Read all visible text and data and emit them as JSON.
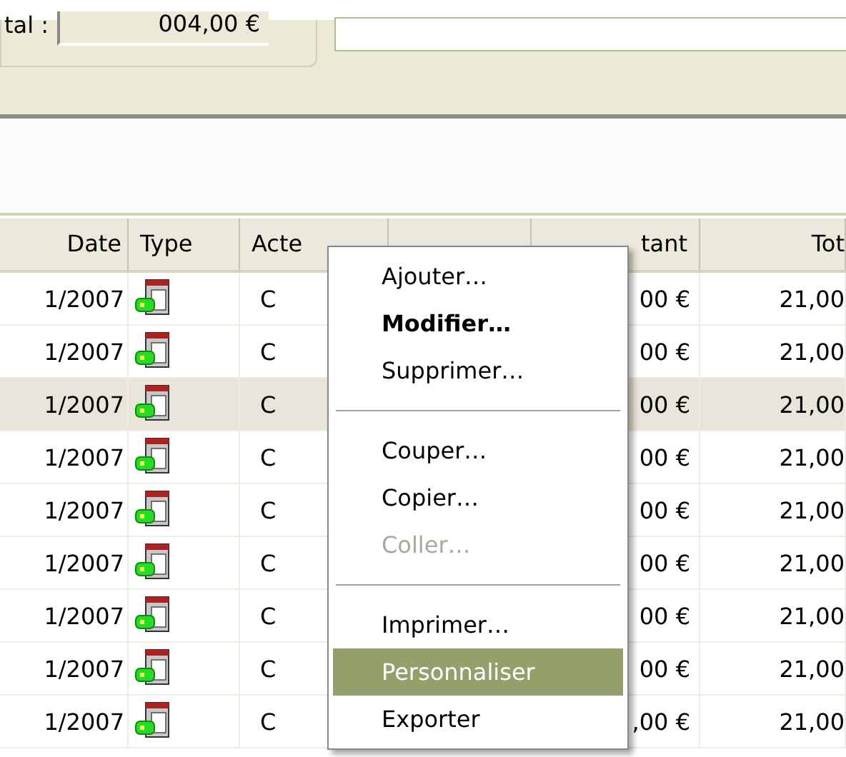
{
  "summary": {
    "label": "tal :",
    "value": "004,00 €"
  },
  "table": {
    "columns": [
      {
        "label": "Date"
      },
      {
        "label": "Type"
      },
      {
        "label": "Acte"
      },
      {},
      {
        "label": "tant"
      },
      {
        "label": "Tot"
      }
    ],
    "rows": [
      {
        "date": "1/2007",
        "acte": "C",
        "montant": "00 €",
        "total": "21,00",
        "selected": false
      },
      {
        "date": "1/2007",
        "acte": "C",
        "montant": "00 €",
        "total": "21,00",
        "selected": false
      },
      {
        "date": "1/2007",
        "acte": "C",
        "montant": "00 €",
        "total": "21,00",
        "selected": true
      },
      {
        "date": "1/2007",
        "acte": "C",
        "montant": "00 €",
        "total": "21,00",
        "selected": false
      },
      {
        "date": "1/2007",
        "acte": "C",
        "montant": "00 €",
        "total": "21,00",
        "selected": false
      },
      {
        "date": "1/2007",
        "acte": "C",
        "montant": "00 €",
        "total": "21,00",
        "selected": false
      },
      {
        "date": "1/2007",
        "acte": "C",
        "montant": "00 €",
        "total": "21,00",
        "selected": false
      },
      {
        "date": "1/2007",
        "acte": "C",
        "montant": "00 €",
        "total": "21,00",
        "selected": false
      },
      {
        "date": "1/2007",
        "acte": "C",
        "montant": ",00 €",
        "total": "21,00",
        "selected": false
      }
    ]
  },
  "context_menu": [
    {
      "kind": "item",
      "label": "Ajouter…",
      "bold": false,
      "disabled": false,
      "selected": false
    },
    {
      "kind": "item",
      "label": "Modifier…",
      "bold": true,
      "disabled": false,
      "selected": false
    },
    {
      "kind": "item",
      "label": "Supprimer…",
      "bold": false,
      "disabled": false,
      "selected": false
    },
    {
      "kind": "separator"
    },
    {
      "kind": "item",
      "label": "Couper…",
      "bold": false,
      "disabled": false,
      "selected": false
    },
    {
      "kind": "item",
      "label": "Copier…",
      "bold": false,
      "disabled": false,
      "selected": false
    },
    {
      "kind": "item",
      "label": "Coller…",
      "bold": false,
      "disabled": true,
      "selected": false
    },
    {
      "kind": "separator"
    },
    {
      "kind": "item",
      "label": "Imprimer…",
      "bold": false,
      "disabled": false,
      "selected": false
    },
    {
      "kind": "item",
      "label": "Personnaliser",
      "bold": false,
      "disabled": false,
      "selected": true
    },
    {
      "kind": "item",
      "label": "Exporter",
      "bold": false,
      "disabled": false,
      "selected": false
    }
  ]
}
